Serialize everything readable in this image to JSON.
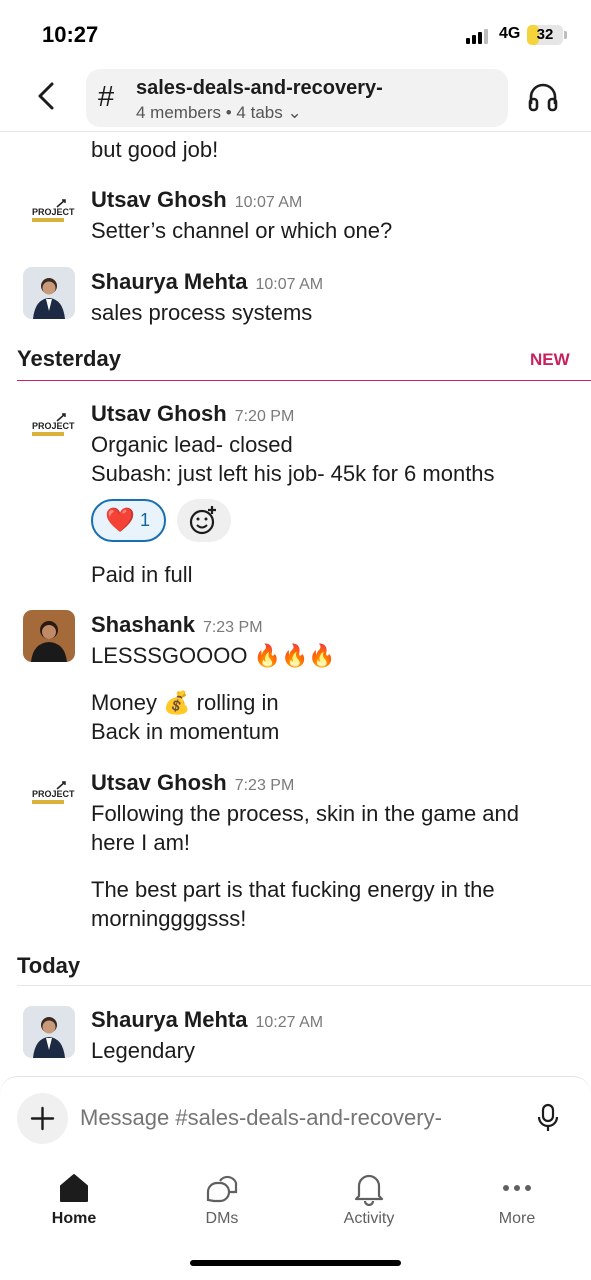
{
  "status_bar": {
    "time": "10:27",
    "network": "4G",
    "battery": "32",
    "battery_level": 0.32
  },
  "header": {
    "channel_name": "sales-deals-and-recovery-",
    "channel_meta": "4 members • 4 tabs ⌄"
  },
  "messages": {
    "top_partial": "but good job!",
    "m1": {
      "user": "Utsav Ghosh",
      "time": "10:07 AM",
      "text": "Setter’s channel or which one?"
    },
    "m2": {
      "user": "Shaurya Mehta",
      "time": "10:07 AM",
      "text": "sales process systems"
    },
    "yesterday_label": "Yesterday",
    "new_label": "NEW",
    "m3": {
      "user": "Utsav Ghosh",
      "time": "7:20 PM",
      "line1": "Organic lead- closed",
      "line2": "Subash: just left his job- 45k for 6 months",
      "reaction_emoji": "❤️",
      "reaction_count": "1",
      "followup": "Paid in full"
    },
    "m4": {
      "user": "Shashank",
      "time": "7:23 PM",
      "line1": "LESSSGOOOO 🔥🔥🔥",
      "line2": "Money 💰 rolling in",
      "line3": "Back in momentum"
    },
    "m5": {
      "user": "Utsav Ghosh",
      "time": "7:23 PM",
      "line1": "Following the process, skin in the game and",
      "line2": "here I am!",
      "line3": "The best part is that fucking energy in the",
      "line4": "morninggggsss!"
    },
    "today_label": "Today",
    "m6": {
      "user": "Shaurya Mehta",
      "time": "10:27 AM",
      "text": "Legendary"
    }
  },
  "composer": {
    "placeholder": "Message #sales-deals-and-recovery-"
  },
  "tabbar": {
    "home": "Home",
    "dms": "DMs",
    "activity": "Activity",
    "more": "More"
  },
  "colors": {
    "accent_new": "#c8215d",
    "reaction_border": "#1a6fb0",
    "text": "#1d1c1d"
  },
  "icons": [
    "back-chevron-icon",
    "hash-icon",
    "headphones-icon",
    "heart-emoji",
    "add-reaction-icon",
    "plus-icon",
    "microphone-icon",
    "home-icon",
    "dms-icon",
    "activity-bell-icon",
    "more-icon"
  ]
}
